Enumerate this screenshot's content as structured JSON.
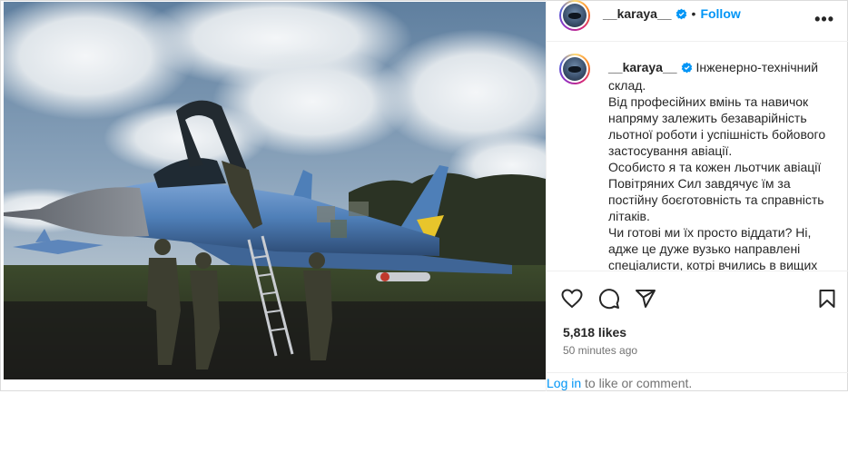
{
  "post": {
    "username": "__karaya__",
    "follow_label": "Follow",
    "dot": "•",
    "more_label": "•••",
    "caption_paragraphs": [
      "Інженерно-технічний склад.",
      "Від професійних вмінь та навичок напряму залежить безаварійність льотної роботи і успішність бойового застосування авіації.",
      "Особисто я та кожен льотчик авіації Повітряних Сил завдячує їм за постійну боєготовність та справність літаків.",
      "Чи готові ми їх просто віддати? Ні, адже це дуже вузько направлені спеціалисти, котрі вчились в вищих"
    ],
    "likes": "5,818 likes",
    "time": "50 minutes ago",
    "login_link": "Log in",
    "login_rest": " to like or comment."
  },
  "icons": {
    "verified": "verified-badge-icon",
    "like": "heart-icon",
    "comment": "comment-icon",
    "share": "paper-plane-icon",
    "save": "bookmark-icon"
  },
  "colors": {
    "accent": "#0095f6",
    "verified": "#0095f6",
    "text": "#262626",
    "muted": "#737373"
  }
}
